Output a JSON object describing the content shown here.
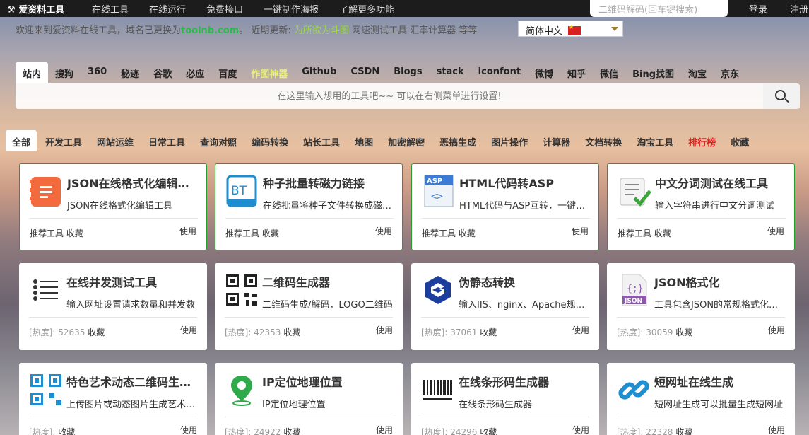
{
  "topbar": {
    "logo": "爱资料工具",
    "nav": [
      "在线工具",
      "在线运行",
      "免费接口",
      "一键制作海报",
      "了解更多功能"
    ],
    "search_placeholder": "二维码解码(回车键搜索)",
    "login": "登录",
    "register": "注册"
  },
  "notice": {
    "prefix": "欢迎来到爱资料在线工具，域名已更换为",
    "domain": "toolnb.com",
    "mid": "。 近期更新:",
    "u1": "为所欲为斗图",
    "u2": "网速测试工具",
    "u3": "汇率计算器",
    "suffix": "等等"
  },
  "language": {
    "label": "简体中文"
  },
  "engines": [
    "站内",
    "搜狗",
    "360",
    "秘迹",
    "谷歌",
    "必应",
    "百度",
    "作图神器",
    "Github",
    "CSDN",
    "Blogs",
    "stack",
    "iconfont",
    "微博",
    "知乎",
    "微信",
    "Bing找图",
    "淘宝",
    "京东"
  ],
  "search": {
    "placeholder": "在这里输入想用的工具吧~~ 可以在右侧菜单进行设置!"
  },
  "categories": [
    "全部",
    "开发工具",
    "网站运维",
    "日常工具",
    "查询对照",
    "编码转换",
    "站长工具",
    "地图",
    "加密解密",
    "恶搞生成",
    "图片操作",
    "计算器",
    "文档转换",
    "淘宝工具",
    "排行榜",
    "收藏"
  ],
  "cards": [
    {
      "title": "JSON在线格式化编辑工具",
      "desc": "JSON在线格式化编辑工具",
      "meta": "推荐工具",
      "hot": "",
      "fav": "收藏",
      "use": "使用",
      "icon": "json-editor-icon"
    },
    {
      "title": "种子批量转磁力链接",
      "desc": "在线批量将种子文件转换成磁力链接",
      "meta": "推荐工具",
      "hot": "",
      "fav": "收藏",
      "use": "使用",
      "icon": "bt-icon"
    },
    {
      "title": "HTML代码转ASP",
      "desc": "HTML代码与ASP互转，一键转换",
      "meta": "推荐工具",
      "hot": "",
      "fav": "收藏",
      "use": "使用",
      "icon": "asp-icon"
    },
    {
      "title": "中文分词测试在线工具",
      "desc": "输入字符串进行中文分词测试",
      "meta": "推荐工具",
      "hot": "",
      "fav": "收藏",
      "use": "使用",
      "icon": "checklist-icon"
    },
    {
      "title": "在线并发测试工具",
      "desc": "输入网址设置请求数量和并发数",
      "meta": "[热度]:",
      "hot": "52635",
      "fav": "收藏",
      "use": "使用",
      "icon": "list-icon"
    },
    {
      "title": "二维码生成器",
      "desc": "二维码生成/解码，LOGO二维码",
      "meta": "[热度]:",
      "hot": "42353",
      "fav": "收藏",
      "use": "使用",
      "icon": "qrcode-icon"
    },
    {
      "title": "伪静态转换",
      "desc": "输入IIS、nginx、Apache规则转换",
      "meta": "[热度]:",
      "hot": "37061",
      "fav": "收藏",
      "use": "使用",
      "icon": "g-logo-icon"
    },
    {
      "title": "JSON格式化",
      "desc": "工具包含JSON的常规格式化操作",
      "meta": "[热度]:",
      "hot": "30059",
      "fav": "收藏",
      "use": "使用",
      "icon": "json-file-icon"
    },
    {
      "title": "特色艺术动态二维码生成器",
      "desc": "上传图片或动态图片生成艺术二维码",
      "meta": "[热度]:",
      "hot": "",
      "fav": "收藏",
      "use": "使用",
      "icon": "art-qrcode-icon"
    },
    {
      "title": "IP定位地理位置",
      "desc": "IP定位地理位置",
      "meta": "[热度]:",
      "hot": "24922",
      "fav": "收藏",
      "use": "使用",
      "icon": "location-pin-icon"
    },
    {
      "title": "在线条形码生成器",
      "desc": "在线条形码生成器",
      "meta": "[热度]:",
      "hot": "24296",
      "fav": "收藏",
      "use": "使用",
      "icon": "barcode-icon"
    },
    {
      "title": "短网址在线生成",
      "desc": "短网址生成可以批量生成短网址",
      "meta": "[热度]:",
      "hot": "22328",
      "fav": "收藏",
      "use": "使用",
      "icon": "link-icon"
    }
  ]
}
